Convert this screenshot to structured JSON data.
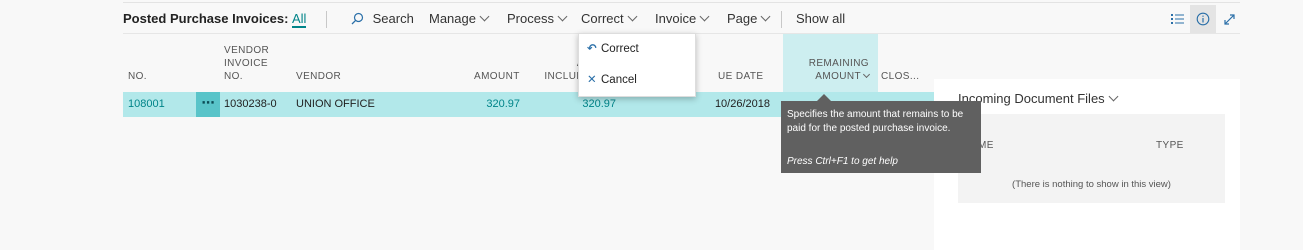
{
  "action_bar": {
    "title": "Posted Purchase Invoices:",
    "view_all": "All",
    "search_label": "Search",
    "manage_label": "Manage",
    "process_label": "Process",
    "correct_label": "Correct",
    "invoice_label": "Invoice",
    "page_label": "Page",
    "show_all_label": "Show all",
    "icons": [
      "list-view-icon",
      "info-icon",
      "expand-icon"
    ]
  },
  "table": {
    "headers": {
      "no": "NO.",
      "vendor_invoice_no": [
        "VENDOR",
        "INVOICE",
        "NO."
      ],
      "vendor": "VENDOR",
      "amount": "AMOUNT",
      "amount_including_vat_partial": [
        "A",
        "INCLUD"
      ],
      "due_date_partial": "UE DATE",
      "remaining_amount": [
        "REMAINING",
        "AMOUNT"
      ],
      "closed_partial": "CLOS..."
    },
    "rows": [
      {
        "no": "108001",
        "actions": "⋯",
        "vendor_invoice_no": "1030238-0",
        "vendor": "UNION OFFICE",
        "amount": "320.97",
        "amount_including_vat": "320.97",
        "due_date": "10/26/2018"
      }
    ]
  },
  "correct_menu": {
    "items": [
      {
        "label": "Correct",
        "icon": "undo-icon"
      },
      {
        "label": "Cancel",
        "icon": "cancel-x-icon"
      }
    ]
  },
  "tooltip": {
    "text": "Specifies the amount that remains to be paid for the posted purchase invoice.",
    "help": "Press Ctrl+F1 to get help"
  },
  "factbox": {
    "title": "Incoming Document Files",
    "col_name_partial": "ME",
    "col_type": "TYPE",
    "empty_text": "(There is nothing to show in this view)"
  },
  "colors": {
    "accent": "#008489",
    "selected_row": "#b2e8ea",
    "tooltip_bg": "#606060"
  }
}
